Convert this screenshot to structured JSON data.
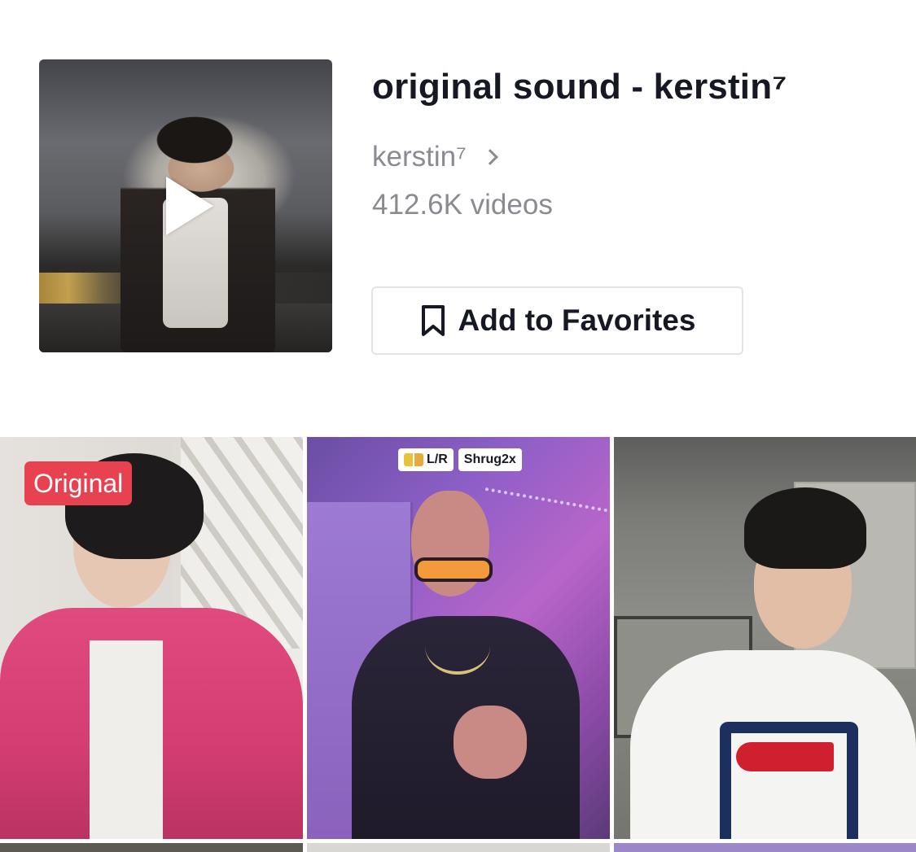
{
  "sound": {
    "title": "original sound - kerstin⁷",
    "author": "kerstin⁷",
    "video_count": "412.6K videos",
    "favorite_label": "Add to Favorites"
  },
  "grid": {
    "tiles": [
      {
        "badge": "Original"
      },
      {
        "tags": [
          "L/R",
          "Shrug2x"
        ]
      },
      {}
    ]
  },
  "colors": {
    "badge_red": "#e8414f",
    "muted_text": "#8a8b91",
    "primary_text": "#161823"
  },
  "icons": {
    "cover_play": "play-icon",
    "author_chevron": "chevron-right-icon",
    "favorite": "bookmark-icon"
  }
}
